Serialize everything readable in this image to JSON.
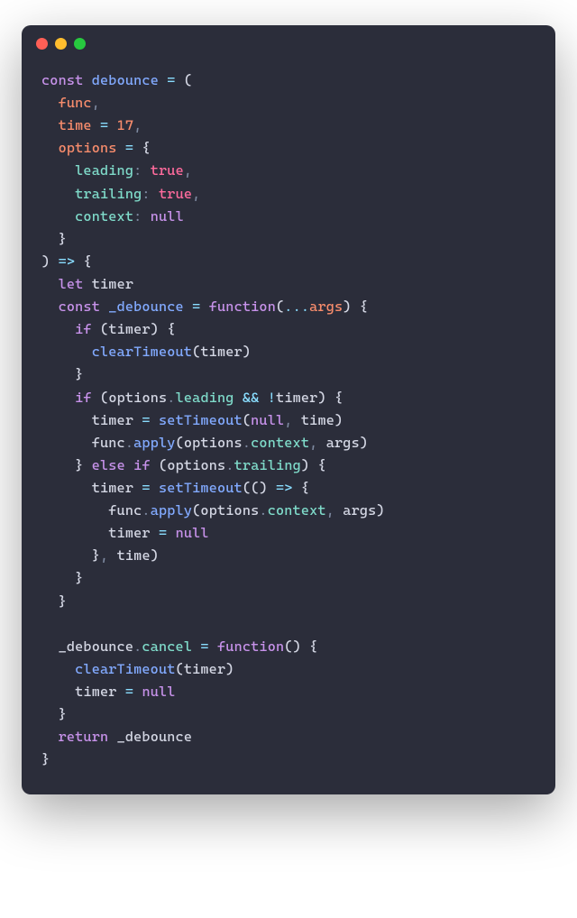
{
  "code": {
    "lines": [
      {
        "t": [
          {
            "c": "kw",
            "s": "const"
          },
          {
            "c": "",
            "s": " "
          },
          {
            "c": "fn",
            "s": "debounce"
          },
          {
            "c": "",
            "s": " "
          },
          {
            "c": "op",
            "s": "="
          },
          {
            "c": "",
            "s": " "
          },
          {
            "c": "paren",
            "s": "("
          }
        ]
      },
      {
        "t": [
          {
            "c": "",
            "s": "  "
          },
          {
            "c": "id",
            "s": "func"
          },
          {
            "c": "punct",
            "s": ","
          }
        ]
      },
      {
        "t": [
          {
            "c": "",
            "s": "  "
          },
          {
            "c": "id",
            "s": "time"
          },
          {
            "c": "",
            "s": " "
          },
          {
            "c": "op",
            "s": "="
          },
          {
            "c": "",
            "s": " "
          },
          {
            "c": "num",
            "s": "17"
          },
          {
            "c": "punct",
            "s": ","
          }
        ]
      },
      {
        "t": [
          {
            "c": "",
            "s": "  "
          },
          {
            "c": "id",
            "s": "options"
          },
          {
            "c": "",
            "s": " "
          },
          {
            "c": "op",
            "s": "="
          },
          {
            "c": "",
            "s": " "
          },
          {
            "c": "paren",
            "s": "{"
          }
        ]
      },
      {
        "t": [
          {
            "c": "",
            "s": "    "
          },
          {
            "c": "prop",
            "s": "leading"
          },
          {
            "c": "punct",
            "s": ":"
          },
          {
            "c": "",
            "s": " "
          },
          {
            "c": "bool",
            "s": "true"
          },
          {
            "c": "punct",
            "s": ","
          }
        ]
      },
      {
        "t": [
          {
            "c": "",
            "s": "    "
          },
          {
            "c": "prop",
            "s": "trailing"
          },
          {
            "c": "punct",
            "s": ":"
          },
          {
            "c": "",
            "s": " "
          },
          {
            "c": "bool",
            "s": "true"
          },
          {
            "c": "punct",
            "s": ","
          }
        ]
      },
      {
        "t": [
          {
            "c": "",
            "s": "    "
          },
          {
            "c": "prop",
            "s": "context"
          },
          {
            "c": "punct",
            "s": ":"
          },
          {
            "c": "",
            "s": " "
          },
          {
            "c": "null",
            "s": "null"
          }
        ]
      },
      {
        "t": [
          {
            "c": "",
            "s": "  "
          },
          {
            "c": "paren",
            "s": "}"
          }
        ]
      },
      {
        "t": [
          {
            "c": "paren",
            "s": ")"
          },
          {
            "c": "",
            "s": " "
          },
          {
            "c": "op",
            "s": "=>"
          },
          {
            "c": "",
            "s": " "
          },
          {
            "c": "paren",
            "s": "{"
          }
        ]
      },
      {
        "t": [
          {
            "c": "",
            "s": "  "
          },
          {
            "c": "kw",
            "s": "let"
          },
          {
            "c": "",
            "s": " "
          },
          {
            "c": "var",
            "s": "timer"
          }
        ]
      },
      {
        "t": [
          {
            "c": "",
            "s": "  "
          },
          {
            "c": "kw",
            "s": "const"
          },
          {
            "c": "",
            "s": " "
          },
          {
            "c": "fn",
            "s": "_debounce"
          },
          {
            "c": "",
            "s": " "
          },
          {
            "c": "op",
            "s": "="
          },
          {
            "c": "",
            "s": " "
          },
          {
            "c": "kw",
            "s": "function"
          },
          {
            "c": "paren",
            "s": "("
          },
          {
            "c": "op",
            "s": "..."
          },
          {
            "c": "id",
            "s": "args"
          },
          {
            "c": "paren",
            "s": ")"
          },
          {
            "c": "",
            "s": " "
          },
          {
            "c": "paren",
            "s": "{"
          }
        ]
      },
      {
        "t": [
          {
            "c": "",
            "s": "    "
          },
          {
            "c": "kw",
            "s": "if"
          },
          {
            "c": "",
            "s": " "
          },
          {
            "c": "paren",
            "s": "("
          },
          {
            "c": "var",
            "s": "timer"
          },
          {
            "c": "paren",
            "s": ")"
          },
          {
            "c": "",
            "s": " "
          },
          {
            "c": "paren",
            "s": "{"
          }
        ]
      },
      {
        "t": [
          {
            "c": "",
            "s": "      "
          },
          {
            "c": "call",
            "s": "clearTimeout"
          },
          {
            "c": "paren",
            "s": "("
          },
          {
            "c": "var",
            "s": "timer"
          },
          {
            "c": "paren",
            "s": ")"
          }
        ]
      },
      {
        "t": [
          {
            "c": "",
            "s": "    "
          },
          {
            "c": "paren",
            "s": "}"
          }
        ]
      },
      {
        "t": [
          {
            "c": "",
            "s": "    "
          },
          {
            "c": "kw",
            "s": "if"
          },
          {
            "c": "",
            "s": " "
          },
          {
            "c": "paren",
            "s": "("
          },
          {
            "c": "var",
            "s": "options"
          },
          {
            "c": "punct",
            "s": "."
          },
          {
            "c": "method",
            "s": "leading"
          },
          {
            "c": "",
            "s": " "
          },
          {
            "c": "op",
            "s": "&&"
          },
          {
            "c": "",
            "s": " "
          },
          {
            "c": "op",
            "s": "!"
          },
          {
            "c": "var",
            "s": "timer"
          },
          {
            "c": "paren",
            "s": ")"
          },
          {
            "c": "",
            "s": " "
          },
          {
            "c": "paren",
            "s": "{"
          }
        ]
      },
      {
        "t": [
          {
            "c": "",
            "s": "      "
          },
          {
            "c": "var",
            "s": "timer"
          },
          {
            "c": "",
            "s": " "
          },
          {
            "c": "op",
            "s": "="
          },
          {
            "c": "",
            "s": " "
          },
          {
            "c": "call",
            "s": "setTimeout"
          },
          {
            "c": "paren",
            "s": "("
          },
          {
            "c": "null",
            "s": "null"
          },
          {
            "c": "punct",
            "s": ","
          },
          {
            "c": "",
            "s": " "
          },
          {
            "c": "var",
            "s": "time"
          },
          {
            "c": "paren",
            "s": ")"
          }
        ]
      },
      {
        "t": [
          {
            "c": "",
            "s": "      "
          },
          {
            "c": "var",
            "s": "func"
          },
          {
            "c": "punct",
            "s": "."
          },
          {
            "c": "call",
            "s": "apply"
          },
          {
            "c": "paren",
            "s": "("
          },
          {
            "c": "var",
            "s": "options"
          },
          {
            "c": "punct",
            "s": "."
          },
          {
            "c": "method",
            "s": "context"
          },
          {
            "c": "punct",
            "s": ","
          },
          {
            "c": "",
            "s": " "
          },
          {
            "c": "var",
            "s": "args"
          },
          {
            "c": "paren",
            "s": ")"
          }
        ]
      },
      {
        "t": [
          {
            "c": "",
            "s": "    "
          },
          {
            "c": "paren",
            "s": "}"
          },
          {
            "c": "",
            "s": " "
          },
          {
            "c": "kw",
            "s": "else"
          },
          {
            "c": "",
            "s": " "
          },
          {
            "c": "kw",
            "s": "if"
          },
          {
            "c": "",
            "s": " "
          },
          {
            "c": "paren",
            "s": "("
          },
          {
            "c": "var",
            "s": "options"
          },
          {
            "c": "punct",
            "s": "."
          },
          {
            "c": "method",
            "s": "trailing"
          },
          {
            "c": "paren",
            "s": ")"
          },
          {
            "c": "",
            "s": " "
          },
          {
            "c": "paren",
            "s": "{"
          }
        ]
      },
      {
        "t": [
          {
            "c": "",
            "s": "      "
          },
          {
            "c": "var",
            "s": "timer"
          },
          {
            "c": "",
            "s": " "
          },
          {
            "c": "op",
            "s": "="
          },
          {
            "c": "",
            "s": " "
          },
          {
            "c": "call",
            "s": "setTimeout"
          },
          {
            "c": "paren",
            "s": "(("
          },
          {
            "c": "paren",
            "s": ")"
          },
          {
            "c": "",
            "s": " "
          },
          {
            "c": "op",
            "s": "=>"
          },
          {
            "c": "",
            "s": " "
          },
          {
            "c": "paren",
            "s": "{"
          }
        ]
      },
      {
        "t": [
          {
            "c": "",
            "s": "        "
          },
          {
            "c": "var",
            "s": "func"
          },
          {
            "c": "punct",
            "s": "."
          },
          {
            "c": "call",
            "s": "apply"
          },
          {
            "c": "paren",
            "s": "("
          },
          {
            "c": "var",
            "s": "options"
          },
          {
            "c": "punct",
            "s": "."
          },
          {
            "c": "method",
            "s": "context"
          },
          {
            "c": "punct",
            "s": ","
          },
          {
            "c": "",
            "s": " "
          },
          {
            "c": "var",
            "s": "args"
          },
          {
            "c": "paren",
            "s": ")"
          }
        ]
      },
      {
        "t": [
          {
            "c": "",
            "s": "        "
          },
          {
            "c": "var",
            "s": "timer"
          },
          {
            "c": "",
            "s": " "
          },
          {
            "c": "op",
            "s": "="
          },
          {
            "c": "",
            "s": " "
          },
          {
            "c": "null",
            "s": "null"
          }
        ]
      },
      {
        "t": [
          {
            "c": "",
            "s": "      "
          },
          {
            "c": "paren",
            "s": "}"
          },
          {
            "c": "punct",
            "s": ","
          },
          {
            "c": "",
            "s": " "
          },
          {
            "c": "var",
            "s": "time"
          },
          {
            "c": "paren",
            "s": ")"
          }
        ]
      },
      {
        "t": [
          {
            "c": "",
            "s": "    "
          },
          {
            "c": "paren",
            "s": "}"
          }
        ]
      },
      {
        "t": [
          {
            "c": "",
            "s": "  "
          },
          {
            "c": "paren",
            "s": "}"
          }
        ]
      },
      {
        "t": [
          {
            "c": "",
            "s": ""
          }
        ]
      },
      {
        "t": [
          {
            "c": "",
            "s": "  "
          },
          {
            "c": "var",
            "s": "_debounce"
          },
          {
            "c": "punct",
            "s": "."
          },
          {
            "c": "method",
            "s": "cancel"
          },
          {
            "c": "",
            "s": " "
          },
          {
            "c": "op",
            "s": "="
          },
          {
            "c": "",
            "s": " "
          },
          {
            "c": "kw",
            "s": "function"
          },
          {
            "c": "paren",
            "s": "()"
          },
          {
            "c": "",
            "s": " "
          },
          {
            "c": "paren",
            "s": "{"
          }
        ]
      },
      {
        "t": [
          {
            "c": "",
            "s": "    "
          },
          {
            "c": "call",
            "s": "clearTimeout"
          },
          {
            "c": "paren",
            "s": "("
          },
          {
            "c": "var",
            "s": "timer"
          },
          {
            "c": "paren",
            "s": ")"
          }
        ]
      },
      {
        "t": [
          {
            "c": "",
            "s": "    "
          },
          {
            "c": "var",
            "s": "timer"
          },
          {
            "c": "",
            "s": " "
          },
          {
            "c": "op",
            "s": "="
          },
          {
            "c": "",
            "s": " "
          },
          {
            "c": "null",
            "s": "null"
          }
        ]
      },
      {
        "t": [
          {
            "c": "",
            "s": "  "
          },
          {
            "c": "paren",
            "s": "}"
          }
        ]
      },
      {
        "t": [
          {
            "c": "",
            "s": "  "
          },
          {
            "c": "kw",
            "s": "return"
          },
          {
            "c": "",
            "s": " "
          },
          {
            "c": "var",
            "s": "_debounce"
          }
        ]
      },
      {
        "t": [
          {
            "c": "paren",
            "s": "}"
          }
        ]
      }
    ]
  }
}
